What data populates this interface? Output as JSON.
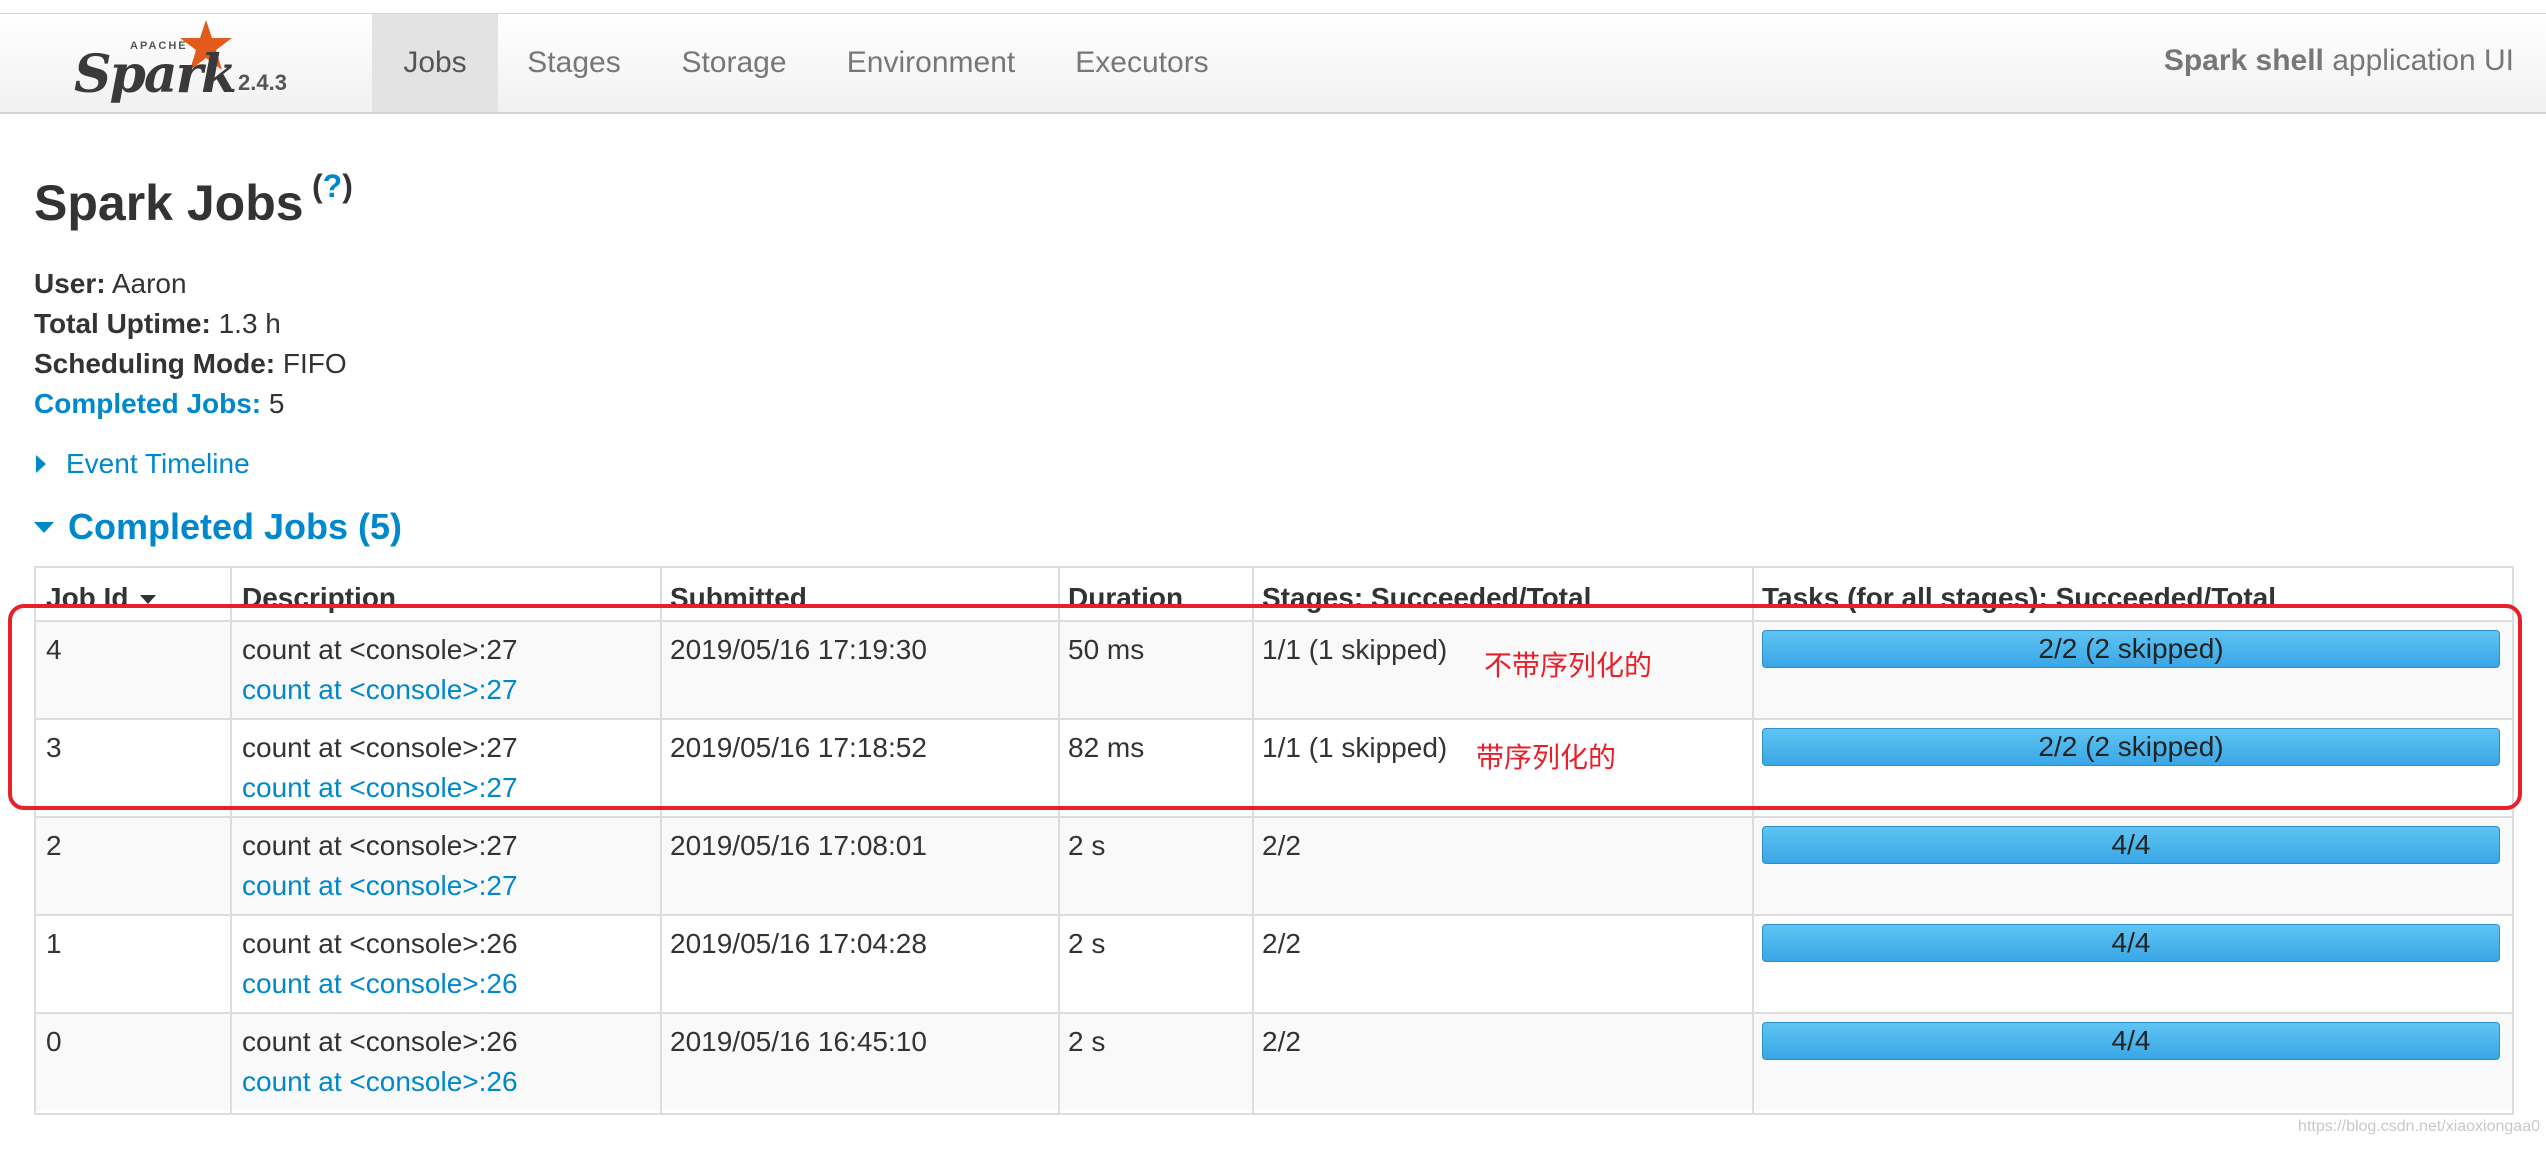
{
  "brand": {
    "apache": "APACHE",
    "name": "Spark",
    "version": "2.4.3"
  },
  "nav": {
    "tabs": [
      {
        "label": "Jobs",
        "active": true
      },
      {
        "label": "Stages",
        "active": false
      },
      {
        "label": "Storage",
        "active": false
      },
      {
        "label": "Environment",
        "active": false
      },
      {
        "label": "Executors",
        "active": false
      }
    ],
    "app_title_bold": "Spark shell",
    "app_title_rest": " application UI"
  },
  "page": {
    "title": "Spark Jobs",
    "help_open": "(",
    "help_q": "?",
    "help_close": ")"
  },
  "summary": {
    "user_label": "User:",
    "user_value": " Aaron",
    "uptime_label": "Total Uptime:",
    "uptime_value": " 1.3 h",
    "mode_label": "Scheduling Mode:",
    "mode_value": " FIFO",
    "completed_label": "Completed Jobs:",
    "completed_value": " 5"
  },
  "event_timeline": "Event Timeline",
  "completed_section": "Completed Jobs (5)",
  "table": {
    "headers": [
      "Job Id",
      "Description",
      "Submitted",
      "Duration",
      "Stages: Succeeded/Total",
      "Tasks (for all stages): Succeeded/Total"
    ],
    "rows": [
      {
        "id": "4",
        "desc": "count at <console>:27",
        "link": "count at <console>:27",
        "submitted": "2019/05/16 17:19:30",
        "duration": "50 ms",
        "stages": "1/1 (1 skipped)",
        "tasks": "2/2 (2 skipped)",
        "note": "不带序列化的"
      },
      {
        "id": "3",
        "desc": "count at <console>:27",
        "link": "count at <console>:27",
        "submitted": "2019/05/16 17:18:52",
        "duration": "82 ms",
        "stages": "1/1 (1 skipped)",
        "tasks": "2/2 (2 skipped)",
        "note": "带序列化的"
      },
      {
        "id": "2",
        "desc": "count at <console>:27",
        "link": "count at <console>:27",
        "submitted": "2019/05/16 17:08:01",
        "duration": "2 s",
        "stages": "2/2",
        "tasks": "4/4"
      },
      {
        "id": "1",
        "desc": "count at <console>:26",
        "link": "count at <console>:26",
        "submitted": "2019/05/16 17:04:28",
        "duration": "2 s",
        "stages": "2/2",
        "tasks": "4/4"
      },
      {
        "id": "0",
        "desc": "count at <console>:26",
        "link": "count at <console>:26",
        "submitted": "2019/05/16 16:45:10",
        "duration": "2 s",
        "stages": "2/2",
        "tasks": "4/4"
      }
    ]
  },
  "watermark": "https://blog.csdn.net/xiaoxiongaa0"
}
